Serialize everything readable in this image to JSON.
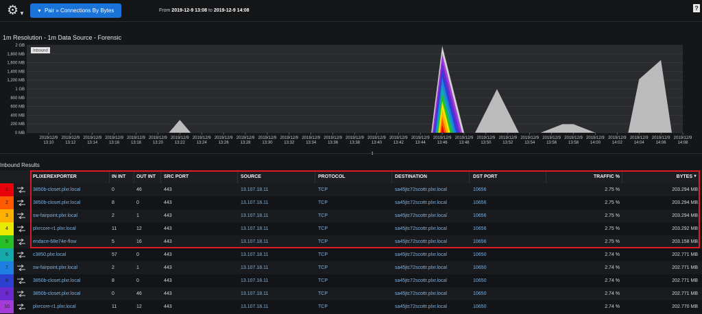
{
  "toolbar": {
    "gear_icon": "gear-icon",
    "pair_label": "Pair » Connections By Bytes",
    "range_from_label": "From",
    "range_from": "2019-12-9 13:08",
    "range_to_label": "to",
    "range_to": "2019-12-9 14:08",
    "help_label": "?"
  },
  "chart_title": "1m Resolution - 1m Data Source - Forensic",
  "chart_data": {
    "type": "area",
    "legend_label": "Inbound",
    "y_ticks": [
      "2 GB",
      "1,800 MB",
      "1,600 MB",
      "1,400 MB",
      "1,200 MB",
      "1 GB",
      "800 MB",
      "600 MB",
      "400 MB",
      "200 MB",
      "0 MB"
    ],
    "x_ticks": [
      "13:10",
      "13:12",
      "13:14",
      "13:16",
      "13:18",
      "13:20",
      "13:22",
      "13:24",
      "13:26",
      "13:28",
      "13:30",
      "13:32",
      "13:34",
      "13:36",
      "13:38",
      "13:40",
      "13:42",
      "13:44",
      "13:46",
      "13:48",
      "13:50",
      "13:52",
      "13:54",
      "13:56",
      "13:58",
      "14:00",
      "14:02",
      "14:04",
      "14:06",
      "14:08"
    ],
    "x_tick_date": "2019/12/9",
    "ylim_mb": [
      0,
      2048
    ],
    "colors": {
      "gray_area": "#c8c8c8",
      "stack": [
        "#e8000b",
        "#ff5a00",
        "#ffb000",
        "#e8e800",
        "#26c026",
        "#15a8a8",
        "#1f7fe0",
        "#2b3fd0",
        "#6b2ad0",
        "#a33bd6",
        "#d0d0d0"
      ]
    },
    "gray_series_mb": [
      {
        "time": "13:08",
        "mb": 0
      },
      {
        "time": "13:21",
        "mb": 0
      },
      {
        "time": "13:22",
        "mb": 300
      },
      {
        "time": "13:23",
        "mb": 0
      },
      {
        "time": "13:49",
        "mb": 0
      },
      {
        "time": "13:51",
        "mb": 1020
      },
      {
        "time": "13:53",
        "mb": 0
      },
      {
        "time": "13:55",
        "mb": 0
      },
      {
        "time": "13:56",
        "mb": 100
      },
      {
        "time": "13:57",
        "mb": 200
      },
      {
        "time": "13:58",
        "mb": 200
      },
      {
        "time": "13:59",
        "mb": 100
      },
      {
        "time": "14:00",
        "mb": 0
      },
      {
        "time": "14:03",
        "mb": 0
      },
      {
        "time": "14:04",
        "mb": 1250
      },
      {
        "time": "14:06",
        "mb": 1700
      },
      {
        "time": "14:07",
        "mb": 0
      }
    ],
    "spike": {
      "start": "13:45",
      "peak": "13:46",
      "end": "13:48",
      "peak_mb": 2030
    }
  },
  "results_title": "Inbound Results",
  "table": {
    "columns": [
      "PLIXEREXPORTER",
      "IN INT",
      "OUT INT",
      "SRC PORT",
      "SOURCE",
      "PROTOCOL",
      "DESTINATION",
      "DST PORT",
      "TRAFFIC %",
      "BYTES"
    ],
    "sort_icon": "sort-desc-icon",
    "rows": [
      {
        "n": "1",
        "color": "#e8000b",
        "exporter": "3850b-closet.plxr.local",
        "in": "0",
        "out": "46",
        "sport": "443",
        "src": "13.107.18.11",
        "proto": "TCP",
        "dst": "sa45jtc72scottr.plxr.local",
        "dport": "10656",
        "pct": "2.75 %",
        "bytes": "203.294 MB"
      },
      {
        "n": "2",
        "color": "#ff5a00",
        "exporter": "3850b-closet.plxr.local",
        "in": "8",
        "out": "0",
        "sport": "443",
        "src": "13.107.18.11",
        "proto": "TCP",
        "dst": "sa45jtc72scottr.plxr.local",
        "dport": "10656",
        "pct": "2.75 %",
        "bytes": "203.294 MB"
      },
      {
        "n": "3",
        "color": "#ffb000",
        "exporter": "sw-fairpoint.plxr.local",
        "in": "2",
        "out": "1",
        "sport": "443",
        "src": "13.107.18.11",
        "proto": "TCP",
        "dst": "sa45jtc72scottr.plxr.local",
        "dport": "10656",
        "pct": "2.75 %",
        "bytes": "203.294 MB"
      },
      {
        "n": "4",
        "color": "#e8e800",
        "exporter": "plxrcore-r1.plxr.local",
        "in": "11",
        "out": "12",
        "sport": "443",
        "src": "13.107.18.11",
        "proto": "TCP",
        "dst": "sa45jtc72scottr.plxr.local",
        "dport": "10656",
        "pct": "2.75 %",
        "bytes": "203.292 MB"
      },
      {
        "n": "5",
        "color": "#26c026",
        "exporter": "endace-68e74e-flow",
        "in": "5",
        "out": "16",
        "sport": "443",
        "src": "13.107.18.11",
        "proto": "TCP",
        "dst": "sa45jtc72scottr.plxr.local",
        "dport": "10656",
        "pct": "2.75 %",
        "bytes": "203.158 MB"
      },
      {
        "n": "6",
        "color": "#15a8a8",
        "exporter": "c3850.plxr.local",
        "in": "57",
        "out": "0",
        "sport": "443",
        "src": "13.107.18.11",
        "proto": "TCP",
        "dst": "sa45jtc72scottr.plxr.local",
        "dport": "10650",
        "pct": "2.74 %",
        "bytes": "202.771 MB"
      },
      {
        "n": "7",
        "color": "#1f7fe0",
        "exporter": "sw-fairpoint.plxr.local",
        "in": "2",
        "out": "1",
        "sport": "443",
        "src": "13.107.18.11",
        "proto": "TCP",
        "dst": "sa45jtc72scottr.plxr.local",
        "dport": "10650",
        "pct": "2.74 %",
        "bytes": "202.771 MB"
      },
      {
        "n": "8",
        "color": "#2b3fd0",
        "exporter": "3850b-closet.plxr.local",
        "in": "8",
        "out": "0",
        "sport": "443",
        "src": "13.107.18.11",
        "proto": "TCP",
        "dst": "sa45jtc72scottr.plxr.local",
        "dport": "10650",
        "pct": "2.74 %",
        "bytes": "202.771 MB"
      },
      {
        "n": "9",
        "color": "#6b2ad0",
        "exporter": "3850b-closet.plxr.local",
        "in": "0",
        "out": "46",
        "sport": "443",
        "src": "13.107.18.11",
        "proto": "TCP",
        "dst": "sa45jtc72scottr.plxr.local",
        "dport": "10650",
        "pct": "2.74 %",
        "bytes": "202.771 MB"
      },
      {
        "n": "10",
        "color": "#a33bd6",
        "exporter": "plxrcore-r1.plxr.local",
        "in": "11",
        "out": "12",
        "sport": "443",
        "src": "13.107.18.11",
        "proto": "TCP",
        "dst": "sa45jtc72scottr.plxr.local",
        "dport": "10650",
        "pct": "2.74 %",
        "bytes": "202.770 MB"
      }
    ]
  }
}
